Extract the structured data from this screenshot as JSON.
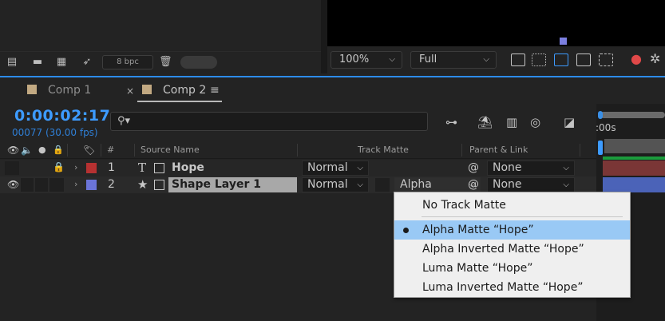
{
  "project_panel": {
    "bpc_label": "8 bpc"
  },
  "viewer": {
    "zoom": "100%",
    "resolution": "Full"
  },
  "tabs": [
    {
      "label": "Comp 1",
      "active": false
    },
    {
      "label": "Comp 2",
      "active": true
    }
  ],
  "timeline": {
    "timecode": "0:00:02:17",
    "frames": "00077 (30.00 fps)",
    "ruler_label": ":00s",
    "columns": {
      "hash": "#",
      "source_name": "Source Name",
      "track_matte": "Track Matte",
      "parent_link": "Parent & Link"
    },
    "layers": [
      {
        "number": "1",
        "type_icon": "T",
        "name": "Hope",
        "label_color": "#b63131",
        "mode": "Normal",
        "track_matte": "",
        "parent": "None",
        "visible": false,
        "locked": true
      },
      {
        "number": "2",
        "type_icon": "★",
        "name": "Shape Layer 1",
        "label_color": "#6b74d8",
        "mode": "Normal",
        "track_matte": "Alpha",
        "parent": "None",
        "visible": true,
        "locked": false
      }
    ]
  },
  "track_matte_menu": {
    "items": [
      {
        "label": "No Track Matte",
        "selected": false
      },
      {
        "label": "Alpha Matte “Hope”",
        "selected": true
      },
      {
        "label": "Alpha Inverted Matte “Hope”",
        "selected": false
      },
      {
        "label": "Luma Matte “Hope”",
        "selected": false
      },
      {
        "label": "Luma Inverted Matte “Hope”",
        "selected": false
      }
    ]
  },
  "colors": {
    "timecode": "#3d9bff",
    "focus_line": "#2d8ceb",
    "menu_highlight": "#99c9f5",
    "track1_bar": "#7a3636",
    "track2_bar": "#4b63b8"
  }
}
